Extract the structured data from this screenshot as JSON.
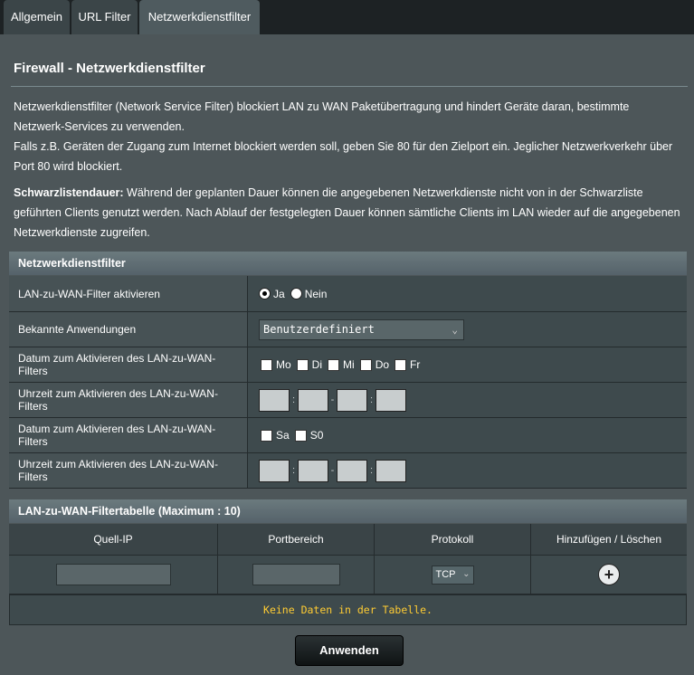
{
  "tabs": [
    {
      "label": "Allgemein"
    },
    {
      "label": "URL Filter"
    },
    {
      "label": "Netzwerkdienstfilter"
    }
  ],
  "title": "Firewall - Netzwerkdienstfilter",
  "description": {
    "line1": "Netzwerkdienstfilter (Network Service Filter) blockiert LAN zu WAN Paketübertragung und hindert Geräte daran, bestimmte Netzwerk-Services zu verwenden.",
    "line2": "Falls z.B. Geräten der Zugang zum Internet blockiert werden soll, geben Sie 80 für den Zielport ein. Jeglicher Netzwerkverkehr über Port 80 wird blockiert.",
    "blacklist_label": "Schwarzlistendauer:",
    "blacklist_text": " Während der geplanten Dauer können die angegebenen Netzwerkdienste nicht von in der Schwarzliste geführten Clients genutzt werden. Nach Ablauf der festgelegten Dauer können sämtliche Clients im LAN wieder auf die angegebenen Netzwerkdienste zugreifen."
  },
  "filter_section": {
    "header": "Netzwerkdienstfilter",
    "enable_label": "LAN-zu-WAN-Filter aktivieren",
    "yes": "Ja",
    "no": "Nein",
    "selected": "Ja",
    "apps_label": "Bekannte Anwendungen",
    "apps_value": "Benutzerdefiniert",
    "weekday_date_label": "Datum zum Aktivieren des LAN-zu-WAN-Filters",
    "weekdays": [
      "Mo",
      "Di",
      "Mi",
      "Do",
      "Fr"
    ],
    "weekday_time_label": "Uhrzeit zum Aktivieren des LAN-zu-WAN-Filters",
    "weekend_date_label": "Datum zum Aktivieren des LAN-zu-WAN-Filters",
    "weekend": [
      "Sa",
      "S0"
    ],
    "weekend_time_label": "Uhrzeit zum Aktivieren des LAN-zu-WAN-Filters",
    "time_sep_colon": ":",
    "time_sep_dash": "-"
  },
  "table": {
    "header": "LAN-zu-WAN-Filtertabelle (Maximum : 10)",
    "columns": [
      "Quell-IP",
      "Portbereich",
      "Protokoll",
      "Hinzufügen / Löschen"
    ],
    "protocol_value": "TCP",
    "empty_text": "Keine Daten in der Tabelle."
  },
  "apply_label": "Anwenden",
  "colors": {
    "accent_empty": "#ffcc33",
    "panel": "#4d5659",
    "header_gradient_top": "#6b7a7e"
  }
}
